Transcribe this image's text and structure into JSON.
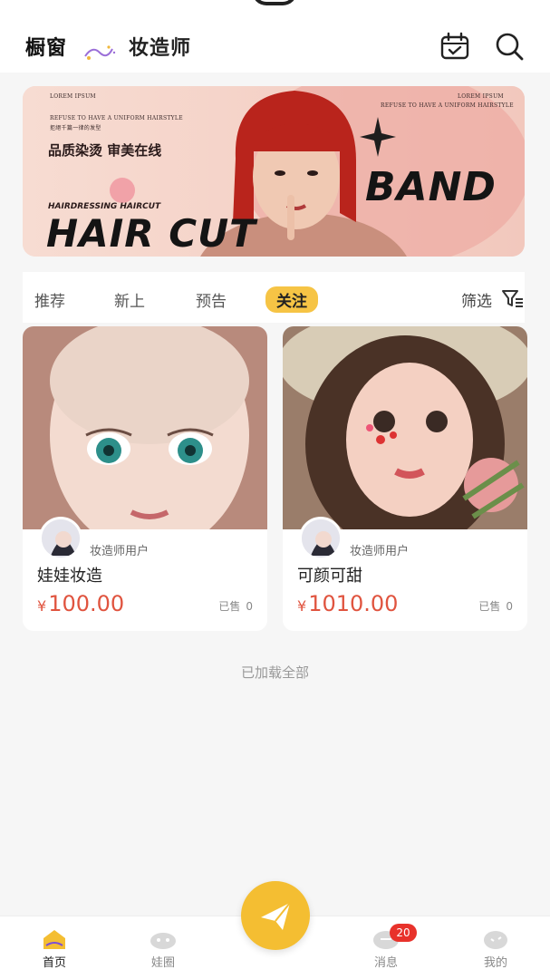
{
  "header": {
    "tab_showcase": "橱窗",
    "tab_makeup_artist": "妆造师"
  },
  "banner": {
    "lorem_left": "LOREM IPSUM",
    "lorem_right": "LOREM IPSUM",
    "refuse_left": "REFUSE TO HAVE A UNIFORM HAIRSTYLE",
    "refuse_right": "REFUSE TO HAVE A UNIFORM HAIRSTYLE",
    "refuse_cn": "拒絕千篇一律的发型",
    "slogan": "品质染烫 审美在线",
    "hairdressing": "HAIRDRESSING HAIRCUT",
    "haircut": "HAIR CUT",
    "band": "BAND"
  },
  "tabs": {
    "recommend": "推荐",
    "new": "新上",
    "preview": "预告",
    "following": "关注",
    "filter": "筛选"
  },
  "products": [
    {
      "seller": "妆造师用户",
      "title": "娃娃妆造",
      "currency": "¥",
      "price": "100.00",
      "sold_label": "已售",
      "sold": "0"
    },
    {
      "seller": "妆造师用户",
      "title": "可颜可甜",
      "currency": "¥",
      "price": "1010.00",
      "sold_label": "已售",
      "sold": "0"
    }
  ],
  "loaded_text": "已加载全部",
  "nav": {
    "home": "首页",
    "circle": "娃圈",
    "messages": "消息",
    "messages_badge": "20",
    "mine": "我的"
  },
  "colors": {
    "accent": "#f6c445",
    "price": "#e0543f",
    "badge": "#e8322b"
  }
}
